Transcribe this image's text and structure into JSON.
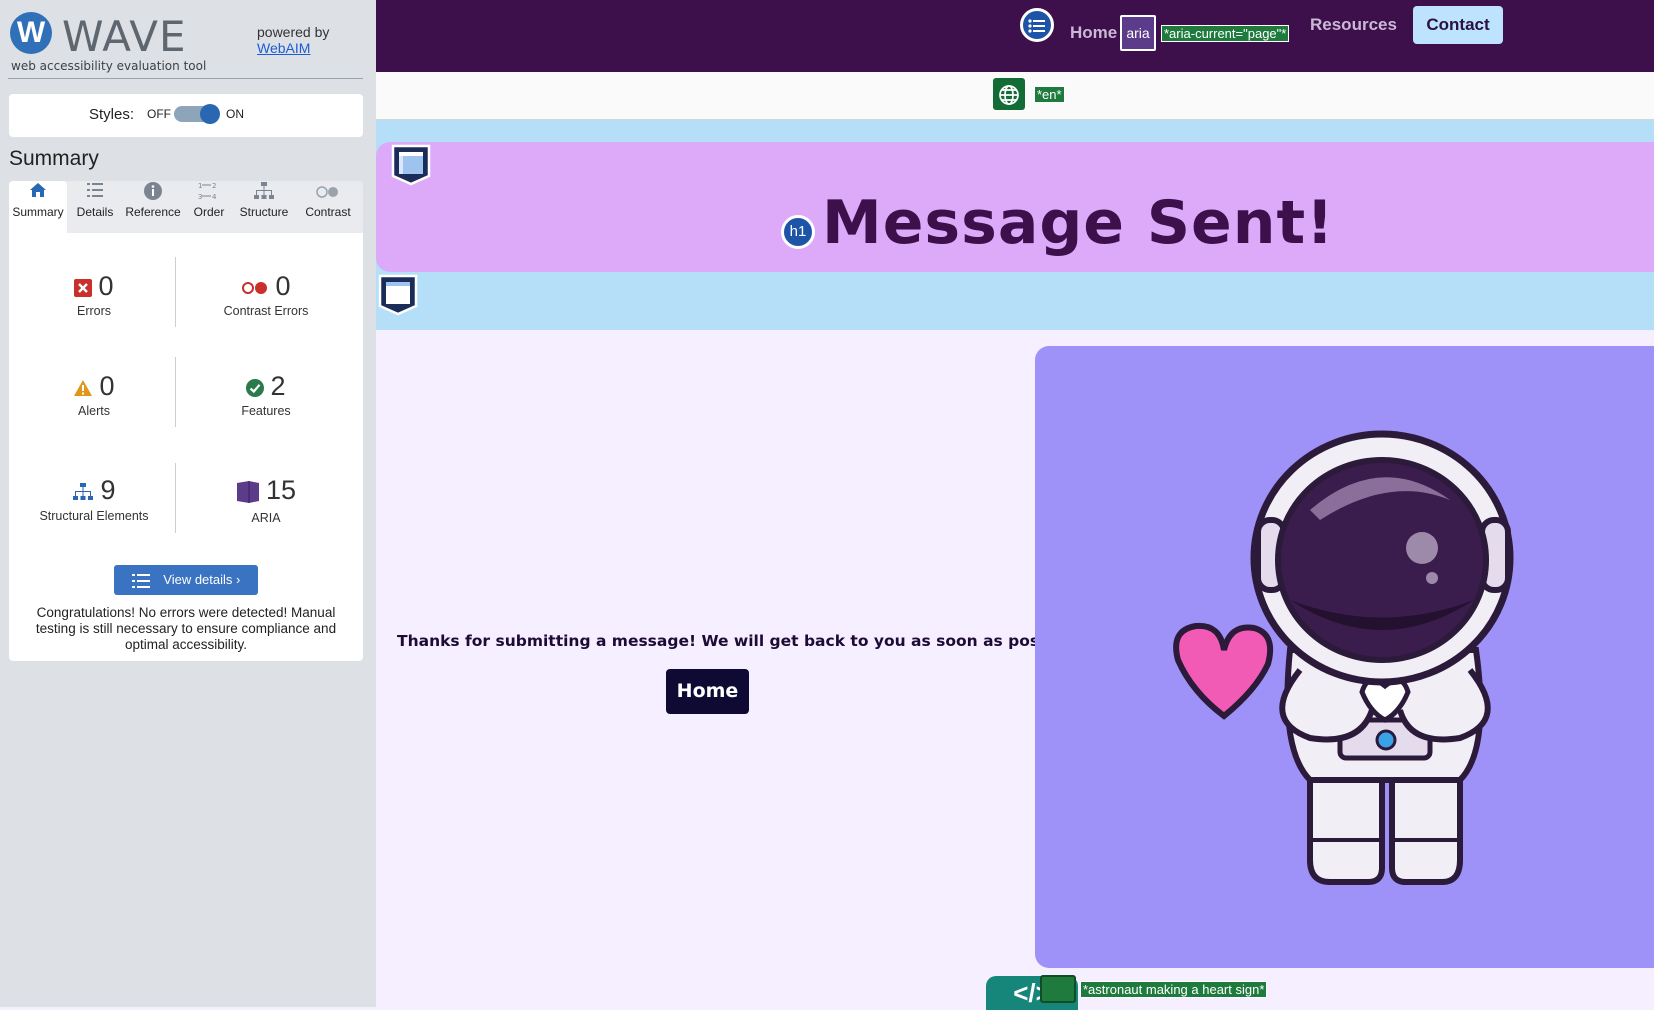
{
  "wave": {
    "logo_letter": "W",
    "title": "WAVE",
    "tagline": "web accessibility evaluation tool",
    "powered_by": "powered by",
    "webaim_link": "WebAIM",
    "styles_label": "Styles:",
    "styles_off": "OFF",
    "styles_on": "ON",
    "summary_heading": "Summary",
    "tabs": [
      {
        "label": "Summary",
        "icon": "home-icon"
      },
      {
        "label": "Details",
        "icon": "list-icon"
      },
      {
        "label": "Reference",
        "icon": "info-icon"
      },
      {
        "label": "Order",
        "icon": "order-icon"
      },
      {
        "label": "Structure",
        "icon": "structure-icon"
      },
      {
        "label": "Contrast",
        "icon": "contrast-icon"
      }
    ],
    "stats": {
      "errors": {
        "count": "0",
        "label": "Errors"
      },
      "contrast_errors": {
        "count": "0",
        "label": "Contrast Errors"
      },
      "alerts": {
        "count": "0",
        "label": "Alerts"
      },
      "features": {
        "count": "2",
        "label": "Features"
      },
      "structural": {
        "count": "9",
        "label": "Structural Elements"
      },
      "aria": {
        "count": "15",
        "label": "ARIA"
      }
    },
    "view_details": "View details ›",
    "congrats": "Congratulations! No errors were detected! Manual testing is still necessary to ensure compliance and optimal accessibility."
  },
  "nav": {
    "home": "Home",
    "aria_badge": "aria",
    "aria_current_label": "*aria-current=\"page\"*",
    "resources": "Resources",
    "contact": "Contact"
  },
  "lang_label": "*en*",
  "h1_badge": "h1",
  "page_title": "Message Sent!",
  "thanks_text": "Thanks for submitting a message! We will get back to you as soon as possible.",
  "home_button": "Home",
  "code_tab": "</>",
  "alt_label": "*astronaut making a heart sign*",
  "colors": {
    "header_bg": "#3d0f4b",
    "hero_bg": "#dcaaf9",
    "band_bg": "#b5dff8",
    "image_panel_bg": "#9e91f7",
    "wave_blue": "#2a67b2",
    "feature_green": "#1f7a3d"
  }
}
